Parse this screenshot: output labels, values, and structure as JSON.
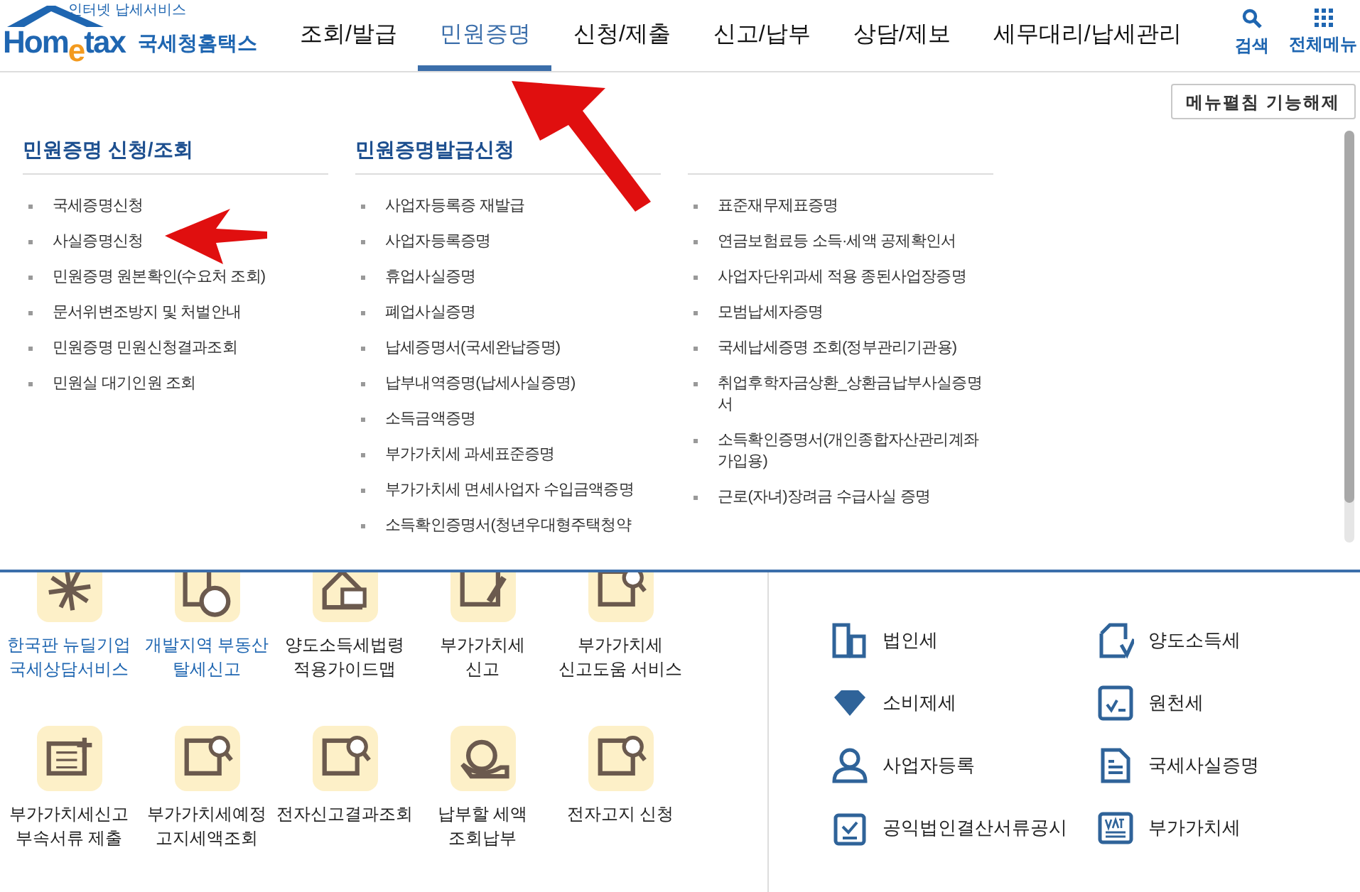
{
  "header": {
    "logo": {
      "tagline": "인터넷 납세서비스",
      "brand": "Hom$_{e}$tax",
      "name": "국세청홈택스"
    },
    "nav": [
      {
        "label": "조회/발급",
        "selected": false
      },
      {
        "label": "민원증명",
        "selected": true
      },
      {
        "label": "신청/제출",
        "selected": false
      },
      {
        "label": "신고/납부",
        "selected": false
      },
      {
        "label": "상담/제보",
        "selected": false
      },
      {
        "label": "세무대리/납세관리",
        "selected": false
      }
    ],
    "utilities": [
      {
        "kind": "search",
        "label": "검색"
      },
      {
        "kind": "all_menu",
        "label": "전체메뉴"
      }
    ]
  },
  "dropdown": {
    "toggle_button": "메뉴펼침 기능해제",
    "columns": [
      {
        "heading": "민원증명 신청/조회",
        "items": [
          "국세증명신청",
          "사실증명신청",
          "민원증명 원본확인(수요처 조회)",
          "문서위변조방지 및 처벌안내",
          "민원증명 민원신청결과조회",
          "민원실 대기인원 조회"
        ]
      },
      {
        "heading": "민원증명발급신청",
        "items": [
          "사업자등록증 재발급",
          "사업자등록증명",
          "휴업사실증명",
          "폐업사실증명",
          "납세증명서(국세완납증명)",
          "납부내역증명(납세사실증명)",
          "소득금액증명",
          "부가가치세 과세표준증명",
          "부가가치세 면세사업자 수입금액증명",
          "소득확인증명서(청년우대형주택청약"
        ]
      },
      {
        "items": [
          "표준재무제표증명",
          "연금보험료등 소득·세액 공제확인서",
          "사업자단위과세 적용 종된사업장증명",
          "모범납세자증명",
          "국세납세증명 조회(정부관리기관용)",
          "취업후학자금상환_상환금납부사실증명서",
          "소득확인증명서(개인종합자산관리계좌 가입용)",
          "근로(자녀)장려금 수급사실 증명"
        ]
      }
    ]
  },
  "services": [
    {
      "label": "한국판 뉴딜기업\n국세상담서비스",
      "featured": true
    },
    {
      "label": "개발지역 부동산\n탈세신고",
      "featured": true
    },
    {
      "label": "양도소득세법령\n적용가이드맵",
      "featured": false
    },
    {
      "label": "부가가치세\n신고",
      "featured": false
    },
    {
      "label": "부가가치세\n신고도움 서비스",
      "featured": false
    },
    {
      "label": "부가가치세신고\n부속서류 제출",
      "featured": false
    },
    {
      "label": "부가가치세예정\n고지세액조회",
      "featured": false
    },
    {
      "label": "전자신고결과조회",
      "featured": false
    },
    {
      "label": "납부할 세액\n조회납부",
      "featured": false
    },
    {
      "label": "전자고지 신청",
      "featured": false
    }
  ],
  "tax_categories": [
    "법인세",
    "양도소득세",
    "소비제세",
    "원천세",
    "사업자등록",
    "국세사실증명",
    "공익법인결산서류공시",
    "부가가치세"
  ]
}
